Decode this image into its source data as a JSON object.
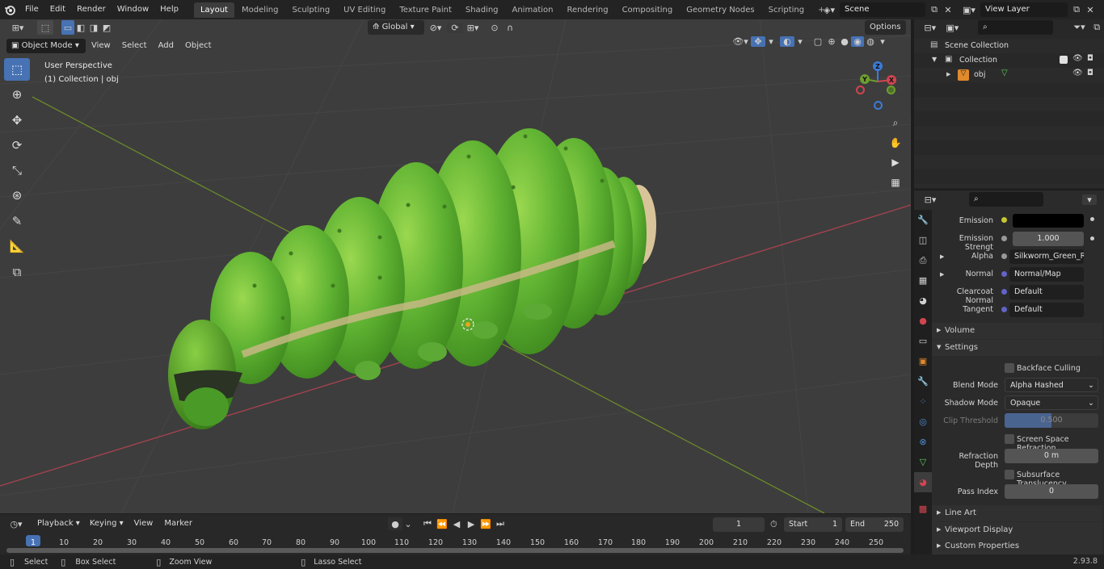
{
  "topbar": {
    "menus": [
      "File",
      "Edit",
      "Render",
      "Window",
      "Help"
    ],
    "workspaces": [
      "Layout",
      "Modeling",
      "Sculpting",
      "UV Editing",
      "Texture Paint",
      "Shading",
      "Animation",
      "Rendering",
      "Compositing",
      "Geometry Nodes",
      "Scripting"
    ],
    "active_workspace": "Layout",
    "add_tab": "+",
    "scene_label": "Scene",
    "view_layer_label": "View Layer"
  },
  "viewport_header": {
    "mode": "Object Mode",
    "menus": [
      "View",
      "Select",
      "Add",
      "Object"
    ],
    "orientation": "Global",
    "options": "Options"
  },
  "viewport": {
    "perspective": "User Perspective",
    "collection_info": "(1) Collection | obj",
    "gizmo_axes": [
      "Z",
      "Y",
      "X"
    ]
  },
  "outliner": {
    "items": [
      {
        "label": "Scene Collection"
      },
      {
        "label": "Collection"
      },
      {
        "label": "obj"
      }
    ]
  },
  "properties": {
    "rows": [
      {
        "label": "Emission",
        "value": ""
      },
      {
        "label": "Emission Strengt",
        "value": "1.000"
      },
      {
        "label": "Alpha",
        "value": "Silkworm_Green_Re..."
      },
      {
        "label": "Normal",
        "value": "Normal/Map"
      },
      {
        "label": "Clearcoat Normal",
        "value": "Default"
      },
      {
        "label": "Tangent",
        "value": "Default"
      }
    ],
    "panels": {
      "volume": "Volume",
      "settings": "Settings",
      "line_art": "Line Art",
      "viewport_display": "Viewport Display",
      "custom_properties": "Custom Properties"
    },
    "settings": {
      "backface_culling": "Backface Culling",
      "blend_mode_label": "Blend Mode",
      "blend_mode": "Alpha Hashed",
      "shadow_mode_label": "Shadow Mode",
      "shadow_mode": "Opaque",
      "clip_threshold_label": "Clip Threshold",
      "clip_threshold": "0.500",
      "ssr_label": "Screen Space Refraction",
      "refraction_depth_label": "Refraction Depth",
      "refraction_depth": "0 m",
      "subsurface_label": "Subsurface Translucency",
      "pass_index_label": "Pass Index",
      "pass_index": "0"
    }
  },
  "timeline": {
    "menus": [
      "Playback",
      "Keying",
      "View",
      "Marker"
    ],
    "current_frame": "1",
    "start_label": "Start",
    "start": "1",
    "end_label": "End",
    "end": "250",
    "ticks": [
      "1",
      "10",
      "20",
      "30",
      "40",
      "50",
      "60",
      "70",
      "80",
      "90",
      "100",
      "110",
      "120",
      "130",
      "140",
      "150",
      "160",
      "170",
      "180",
      "190",
      "200",
      "210",
      "220",
      "230",
      "240",
      "250"
    ]
  },
  "statusbar": {
    "select": "Select",
    "box_select": "Box Select",
    "zoom_view": "Zoom View",
    "lasso_select": "Lasso Select",
    "version": "2.93.8"
  }
}
